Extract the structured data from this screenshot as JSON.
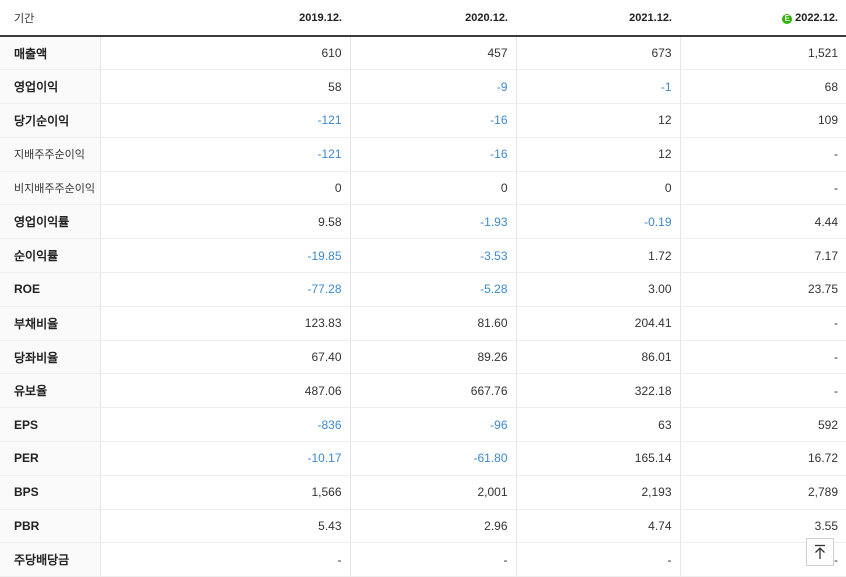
{
  "header": {
    "label": "기간",
    "periods": [
      "2019.12.",
      "2020.12.",
      "2021.12.",
      "2022.12."
    ],
    "estimate_mark": "E",
    "estimate_color": "#2db400"
  },
  "colors": {
    "negative": "#3c89d0",
    "text": "#333333"
  },
  "rows": [
    {
      "label": "매출액",
      "values": [
        "610",
        "457",
        "673",
        "1,521"
      ]
    },
    {
      "label": "영업이익",
      "values": [
        "58",
        "-9",
        "-1",
        "68"
      ]
    },
    {
      "label": "당기순이익",
      "values": [
        "-121",
        "-16",
        "12",
        "109"
      ]
    },
    {
      "label": "지배주주순이익",
      "values": [
        "-121",
        "-16",
        "12",
        "-"
      ]
    },
    {
      "label": "비지배주주순이익",
      "values": [
        "0",
        "0",
        "0",
        "-"
      ]
    },
    {
      "label": "영업이익률",
      "values": [
        "9.58",
        "-1.93",
        "-0.19",
        "4.44"
      ]
    },
    {
      "label": "순이익률",
      "values": [
        "-19.85",
        "-3.53",
        "1.72",
        "7.17"
      ]
    },
    {
      "label": "ROE",
      "values": [
        "-77.28",
        "-5.28",
        "3.00",
        "23.75"
      ]
    },
    {
      "label": "부채비율",
      "values": [
        "123.83",
        "81.60",
        "204.41",
        "-"
      ]
    },
    {
      "label": "당좌비율",
      "values": [
        "67.40",
        "89.26",
        "86.01",
        "-"
      ]
    },
    {
      "label": "유보율",
      "values": [
        "487.06",
        "667.76",
        "322.18",
        "-"
      ]
    },
    {
      "label": "EPS",
      "values": [
        "-836",
        "-96",
        "63",
        "592"
      ]
    },
    {
      "label": "PER",
      "values": [
        "-10.17",
        "-61.80",
        "165.14",
        "16.72"
      ]
    },
    {
      "label": "BPS",
      "values": [
        "1,566",
        "2,001",
        "2,193",
        "2,789"
      ]
    },
    {
      "label": "PBR",
      "values": [
        "5.43",
        "2.96",
        "4.74",
        "3.55"
      ]
    },
    {
      "label": "주당배당금",
      "values": [
        "-",
        "-",
        "-",
        "-"
      ]
    }
  ],
  "scroll_top_icon": "arrow-up-icon"
}
